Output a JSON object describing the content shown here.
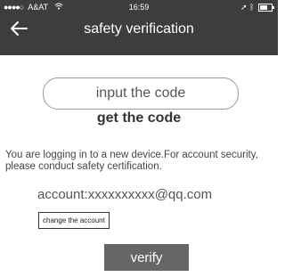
{
  "status_bar": {
    "carrier": "A&AT",
    "time": "16:59",
    "icons": [
      "signal-dots-icon",
      "wifi-icon",
      "location-arrow-icon",
      "bluetooth-icon",
      "battery-icon"
    ]
  },
  "header": {
    "title": "safety verification",
    "back_icon": "back-arrow-icon"
  },
  "form": {
    "code_input_placeholder": "input the code",
    "get_code_label": "get the code",
    "message": "You are logging in to a new device.For account security, please conduct safety certification.",
    "account_text": "account:xxxxxxxxxx@qq.com",
    "change_account_label": "change the account",
    "verify_label": "verify"
  },
  "colors": {
    "header_bg": "#3d3d3d",
    "verify_bg": "#666666"
  }
}
